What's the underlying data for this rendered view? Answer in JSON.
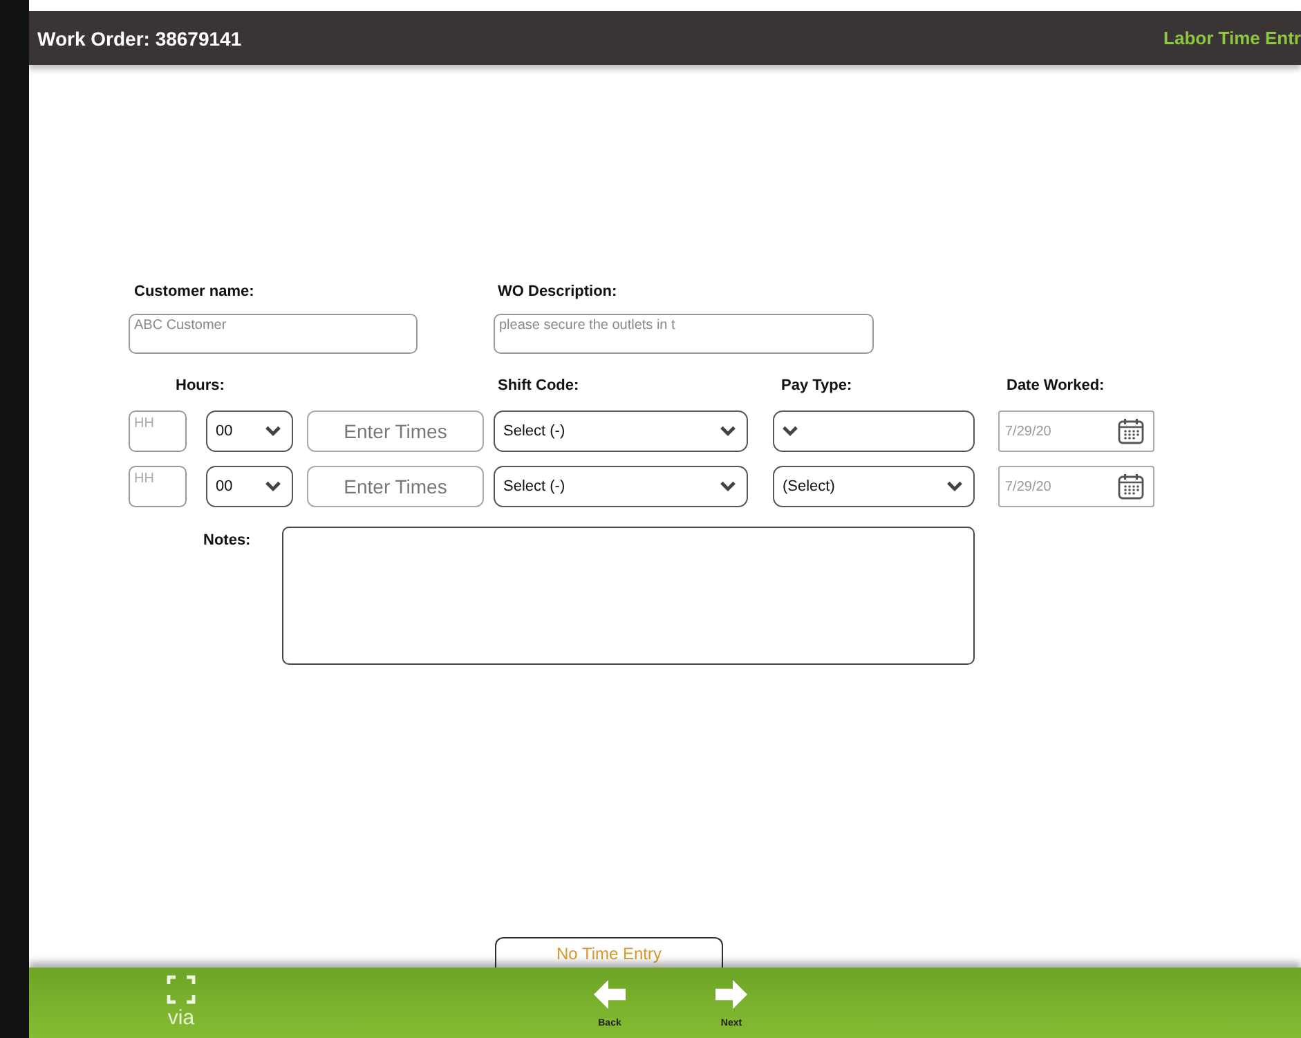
{
  "header": {
    "title": "Work Order: 38679141",
    "section": "Labor Time Entr"
  },
  "customer": {
    "label": "Customer name:",
    "value": "ABC Customer"
  },
  "description": {
    "label": "WO Description:",
    "value": "please secure the outlets in t"
  },
  "time_headers": [
    "Hours:",
    "Shift Code:",
    "Pay Type:",
    "Date Worked:"
  ],
  "entries": [
    {
      "hours_placeholder": "HH",
      "minutes": "00",
      "times_button": "Enter Times",
      "shift_code": "Select (-)",
      "date": "7/29/20"
    },
    {
      "hours_placeholder": "HH",
      "minutes": "00",
      "times_button": "Enter Times",
      "shift_code": "Select (-)",
      "pay_type": "(Select)",
      "date": "7/29/20"
    }
  ],
  "notes": {
    "label": "Notes:"
  },
  "no_time_entry": "No Time Entry",
  "footer": {
    "logo_text": "via",
    "nav": [
      {
        "kind": "back",
        "label": "Back"
      },
      {
        "kind": "next",
        "label": "Next"
      }
    ]
  }
}
